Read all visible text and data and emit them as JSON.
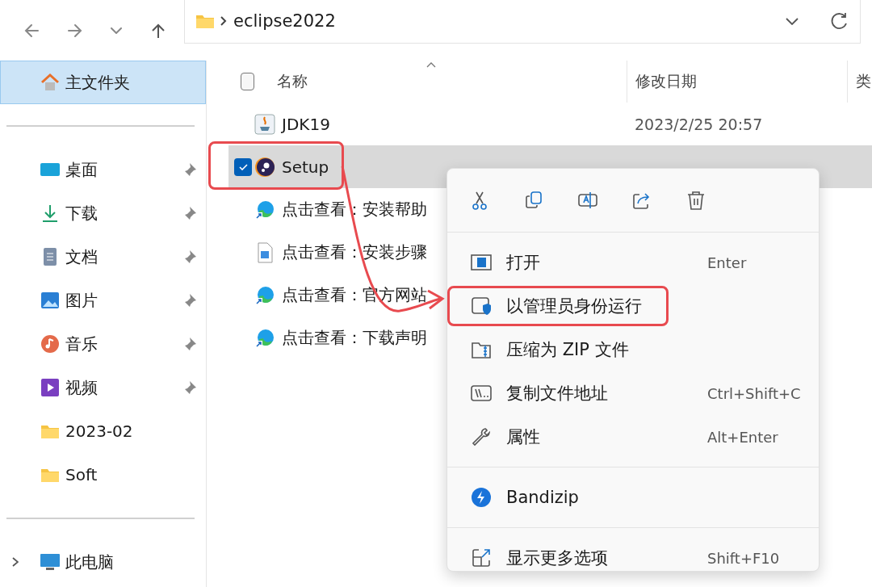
{
  "nav_buttons": [
    {
      "kind": "back"
    },
    {
      "kind": "forward"
    },
    {
      "kind": "history"
    },
    {
      "kind": "up"
    }
  ],
  "address_bar": {
    "segment": "eclipse2022"
  },
  "sidebar": {
    "sections": [
      [
        {
          "label": "主文件夹",
          "kind": "home",
          "selected": true,
          "pinned": false
        }
      ],
      [
        {
          "label": "桌面",
          "kind": "desktop",
          "selected": false,
          "pinned": true
        },
        {
          "label": "下载",
          "kind": "downloads",
          "selected": false,
          "pinned": true
        },
        {
          "label": "文档",
          "kind": "documents",
          "selected": false,
          "pinned": true
        },
        {
          "label": "图片",
          "kind": "pictures",
          "selected": false,
          "pinned": true
        },
        {
          "label": "音乐",
          "kind": "music",
          "selected": false,
          "pinned": true
        },
        {
          "label": "视频",
          "kind": "videos",
          "selected": false,
          "pinned": true
        },
        {
          "label": "2023-02",
          "kind": "folder",
          "selected": false,
          "pinned": false
        },
        {
          "label": "Soft",
          "kind": "folder",
          "selected": false,
          "pinned": false
        }
      ],
      [
        {
          "label": "此电脑",
          "kind": "pc",
          "selected": false,
          "pinned": false,
          "expanded": false
        }
      ]
    ]
  },
  "file_list": {
    "header_checkbox": {
      "checked": false
    },
    "columns": [
      {
        "label": "名称",
        "sorted": true
      },
      {
        "label": "修改日期",
        "sorted": false
      },
      {
        "label": "类",
        "sorted": false
      }
    ],
    "rows": [
      {
        "name": "JDK19",
        "kind": "java",
        "date": "2023/2/25 20:57",
        "selected": false,
        "checked": false,
        "annotated": false
      },
      {
        "name": "Setup",
        "kind": "setup",
        "selected": true,
        "checked": true,
        "annotated": true
      },
      {
        "name": "点击查看：安装帮助",
        "kind": "edge",
        "selected": false,
        "checked": false,
        "annotated": false
      },
      {
        "name": "点击查看：安装步骤",
        "kind": "image",
        "selected": false,
        "checked": false,
        "annotated": false
      },
      {
        "name": "点击查看：官方网站",
        "kind": "edge",
        "selected": false,
        "checked": false,
        "annotated": false
      },
      {
        "name": "点击查看：下载声明",
        "kind": "edge",
        "selected": false,
        "checked": false,
        "annotated": false
      }
    ]
  },
  "context_menu": {
    "toolbar": [
      {
        "kind": "cut"
      },
      {
        "kind": "copy"
      },
      {
        "kind": "rename"
      },
      {
        "kind": "share"
      },
      {
        "kind": "delete"
      }
    ],
    "groups": [
      [
        {
          "label": "打开",
          "kind": "open",
          "shortcut": "Enter",
          "annotated": false
        },
        {
          "label": "以管理员身份运行",
          "kind": "admin",
          "annotated": true
        },
        {
          "label": "压缩为 ZIP 文件",
          "kind": "zip",
          "annotated": false
        },
        {
          "label": "复制文件地址",
          "kind": "path",
          "shortcut": "Ctrl+Shift+C",
          "annotated": false
        },
        {
          "label": "属性",
          "kind": "properties",
          "shortcut": "Alt+Enter",
          "annotated": false
        }
      ],
      [
        {
          "label": "Bandizip",
          "kind": "bandizip",
          "annotated": false
        }
      ],
      [
        {
          "label": "显示更多选项",
          "kind": "more",
          "shortcut": "Shift+F10",
          "annotated": false
        }
      ]
    ]
  }
}
